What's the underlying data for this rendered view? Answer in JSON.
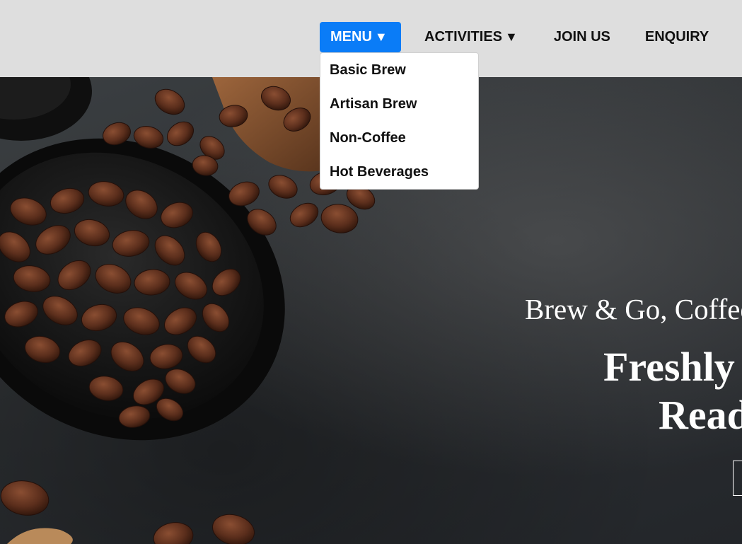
{
  "nav": {
    "menu_label": "MENU",
    "activities_label": "ACTIVITIES",
    "join_label": "JOIN US",
    "enquiry_label": "ENQUIRY",
    "caret": "▼",
    "accent_color": "#0a7cf7"
  },
  "menu_dropdown": {
    "items": [
      {
        "label": "Basic Brew"
      },
      {
        "label": "Artisan Brew"
      },
      {
        "label": "Non-Coffee"
      },
      {
        "label": "Hot Beverages"
      }
    ]
  },
  "hero": {
    "tagline": "Brew & Go, Coffee",
    "headline_line1": "Freshly",
    "headline_line2": "Read",
    "background_image": "coffee beans in dark bowl on stone surface",
    "cta_label": ""
  }
}
